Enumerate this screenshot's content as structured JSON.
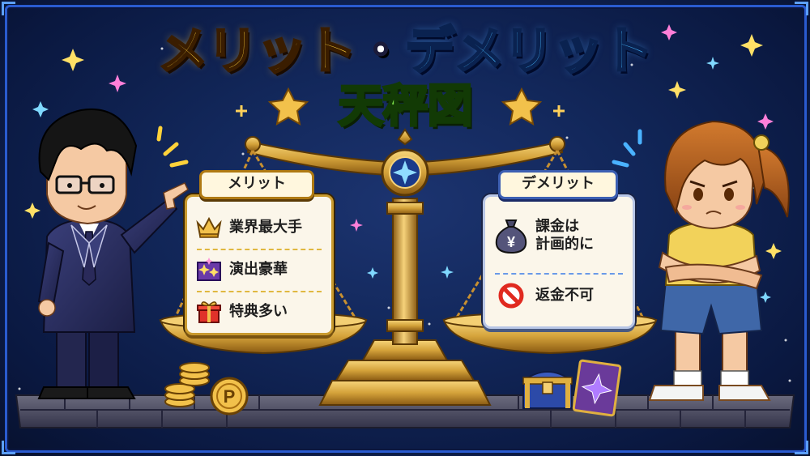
{
  "title": {
    "line1_merit": "メリット",
    "line1_dot": "・",
    "line1_demerit": "デメリット",
    "line2": "天秤図"
  },
  "merit": {
    "tag": "メリット",
    "items": [
      {
        "icon": "crown-icon",
        "label": "業界最大手"
      },
      {
        "icon": "sparkle-stage-icon",
        "label": "演出豪華"
      },
      {
        "icon": "gift-box-icon",
        "label": "特典多い"
      }
    ]
  },
  "demerit": {
    "tag": "デメリット",
    "items": [
      {
        "icon": "yen-money-bag-icon",
        "label_line1": "課金は",
        "label_line2": "計画的に"
      },
      {
        "icon": "prohibited-icon",
        "label": "返金不可"
      }
    ]
  },
  "coin_mark": "P",
  "bag_mark": "¥",
  "colors": {
    "background": "#12275a",
    "frame": "#2a5bd0",
    "merit_title": "#ffd33d",
    "demerit_title": "#46b8ff",
    "subtitle": "#7be04a",
    "gold": "#d4a23a"
  }
}
